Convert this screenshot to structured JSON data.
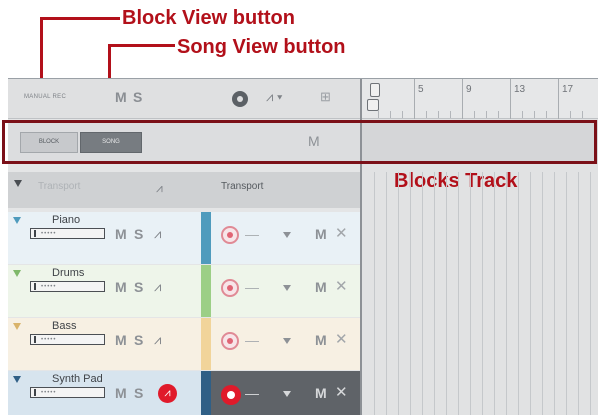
{
  "annotations": {
    "block_view": "Block View button",
    "song_view": "Song View button",
    "blocks_track": "Blocks Track"
  },
  "toolbar": {
    "manual_rec": "MANUAL REC",
    "m_label": "M",
    "s_label": "S",
    "wave_symbol": "⩘ ▾",
    "grid_symbol": "⊞"
  },
  "ruler": {
    "bars": [
      "5",
      "9",
      "13",
      "17"
    ]
  },
  "blocks": {
    "block_label": "BLOCK",
    "song_label": "SONG",
    "m_label": "M"
  },
  "transport": {
    "name": "Transport",
    "wave_symbol": "⩘",
    "label": "Transport"
  },
  "tracks": [
    {
      "name": "Piano",
      "m": "M",
      "s": "S",
      "wave": "⩘",
      "dash": "—",
      "mid_m": "M",
      "close": "✕",
      "color": "#4f9bbd",
      "bg": "#e9f1f6"
    },
    {
      "name": "Drums",
      "m": "M",
      "s": "S",
      "wave": "⩘",
      "dash": "—",
      "mid_m": "M",
      "close": "✕",
      "color": "#9ccf86",
      "bg": "#eef5ea"
    },
    {
      "name": "Bass",
      "m": "M",
      "s": "S",
      "wave": "⩘",
      "dash": "—",
      "mid_m": "M",
      "close": "✕",
      "color": "#f1d49a",
      "bg": "#f7f0e3"
    },
    {
      "name": "Synth Pad",
      "m": "M",
      "s": "S",
      "wave": "⩘",
      "dash": "—",
      "mid_m": "M",
      "close": "✕",
      "color": "#2f5f86",
      "bg": "#d7e4ee"
    }
  ],
  "colors": {
    "annotation": "#b2101a",
    "outline": "#7b1018",
    "rec_active": "#e01a2a"
  }
}
